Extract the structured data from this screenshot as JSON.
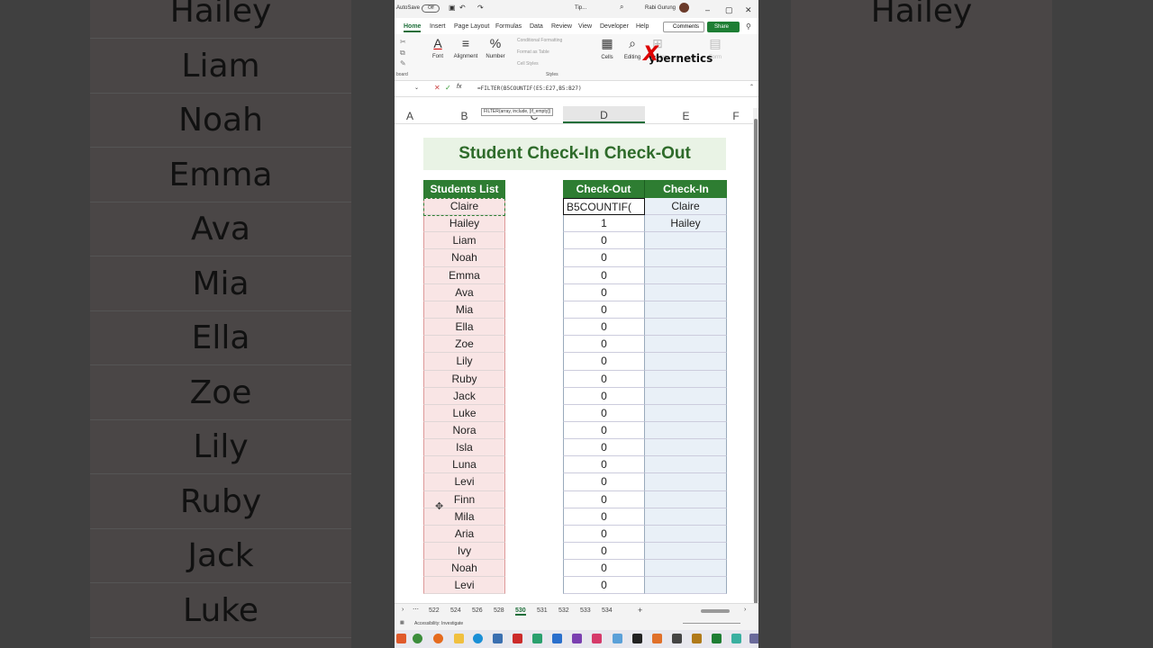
{
  "titlebar": {
    "autosave": "AutoSave",
    "toggle": "Off",
    "filename": "Tip...",
    "user": "Rabi Gurung"
  },
  "menu": {
    "tabs": [
      "Home",
      "Insert",
      "Page Layout",
      "Formulas",
      "Data",
      "Review",
      "View",
      "Developer",
      "Help"
    ],
    "comments": "Comments",
    "share": "Share"
  },
  "ribbon": {
    "font": "Font",
    "alignment": "Alignment",
    "number": "Number",
    "cells": "Cells",
    "editing": "Editing",
    "conditional": "Conditional Formatting",
    "format_table": "Format as Table",
    "cell_styles": "Cell Styles",
    "styles": "Styles",
    "clipboard": "board",
    "addins": "Add-ins",
    "form": "Form"
  },
  "logo": {
    "x": "X",
    "text": "ybernetics"
  },
  "formula_bar": {
    "text": "=FILTER(B5COUNTIF(E5:E27,B5:B27)",
    "tooltip": "FILTER(array, include, [if_empty])"
  },
  "columns": [
    "A",
    "B",
    "C",
    "D",
    "E",
    "F"
  ],
  "sheet": {
    "title": "Student Check-In Check-Out",
    "headers": {
      "students": "Students List",
      "checkout": "Check-Out",
      "checkin": "Check-In"
    },
    "students": [
      "Claire",
      "Hailey",
      "Liam",
      "Noah",
      "Emma",
      "Ava",
      "Mia",
      "Ella",
      "Zoe",
      "Lily",
      "Ruby",
      "Jack",
      "Luke",
      "Nora",
      "Isla",
      "Luna",
      "Levi",
      "Finn",
      "Mila",
      "Aria",
      "Ivy",
      "Noah",
      "Levi"
    ],
    "checkout": [
      "B5COUNTIF(",
      "1",
      "0",
      "0",
      "0",
      "0",
      "0",
      "0",
      "0",
      "0",
      "0",
      "0",
      "0",
      "0",
      "0",
      "0",
      "0",
      "0",
      "0",
      "0",
      "0",
      "0",
      "0"
    ],
    "checkin": [
      "Claire",
      "Hailey"
    ]
  },
  "sheet_tabs": [
    "522",
    "524",
    "526",
    "528",
    "530",
    "531",
    "532",
    "533",
    "534"
  ],
  "active_tab": "530",
  "status": {
    "accessibility": "Accessibility: Investigate"
  },
  "background_names_left": [
    "Hailey",
    "Liam",
    "Noah",
    "Emma",
    "Ava",
    "Mia",
    "Ella",
    "Zoe",
    "Lily",
    "Ruby",
    "Jack",
    "Luke"
  ],
  "background_names_right": [
    "Hailey"
  ]
}
